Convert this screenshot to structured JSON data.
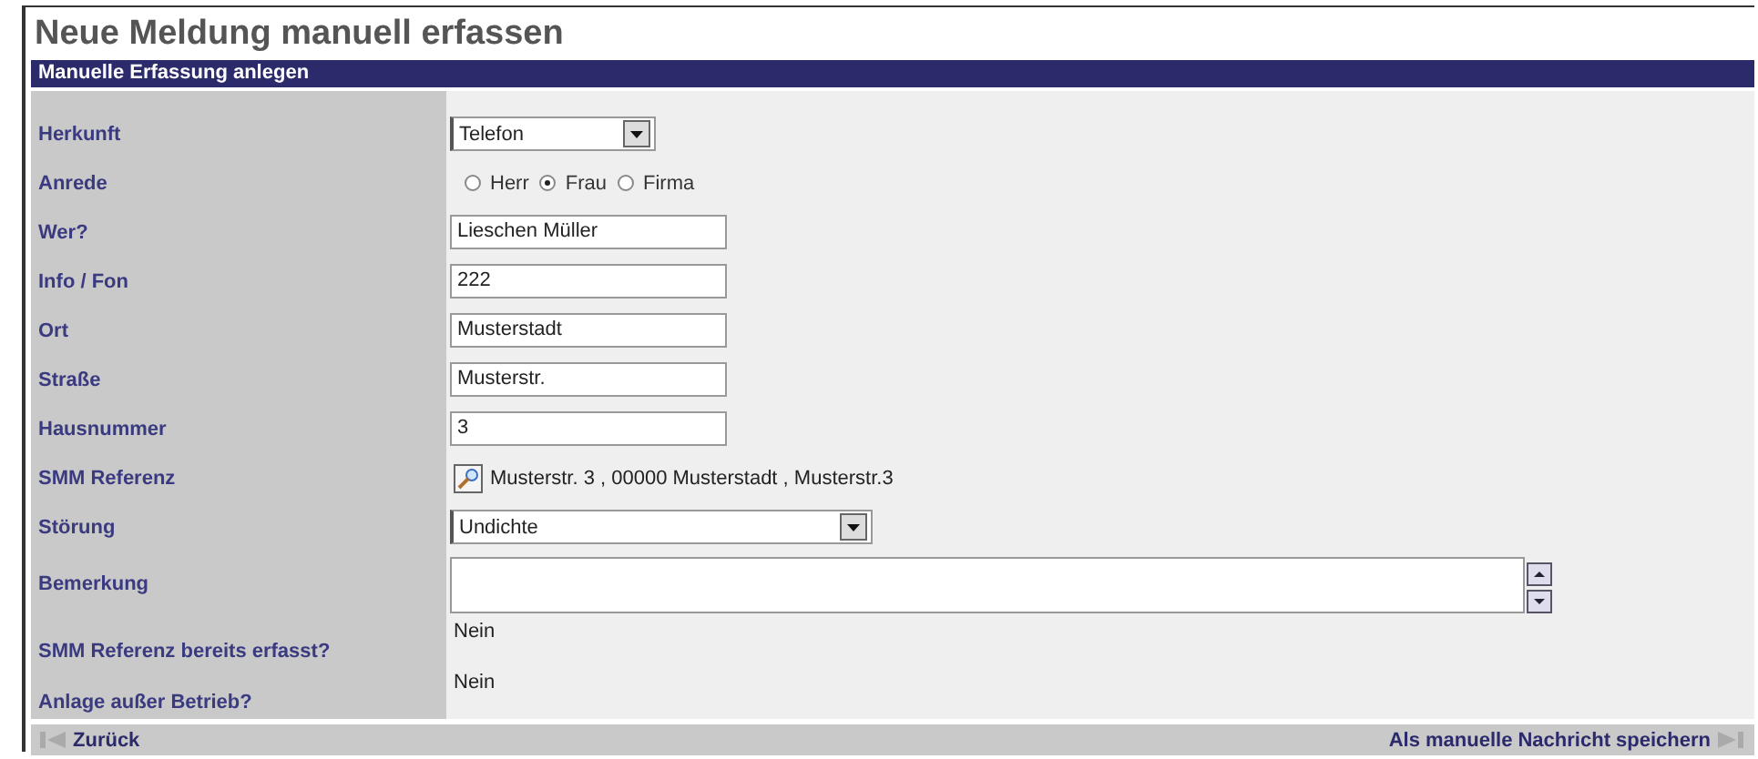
{
  "title": "Neue Meldung manuell erfassen",
  "section_header": "Manuelle Erfassung anlegen",
  "fields": [
    {
      "kind": "select",
      "label": "Herkunft",
      "value": "Telefon"
    },
    {
      "kind": "radio",
      "label": "Anrede",
      "options": [
        {
          "label": "Herr",
          "selected": false
        },
        {
          "label": "Frau",
          "selected": true
        },
        {
          "label": "Firma",
          "selected": false
        }
      ]
    },
    {
      "kind": "text",
      "label": "Wer?",
      "value": "Lieschen Müller"
    },
    {
      "kind": "text",
      "label": "Info / Fon",
      "value": "222"
    },
    {
      "kind": "text",
      "label": "Ort",
      "value": "Musterstadt"
    },
    {
      "kind": "text",
      "label": "Straße",
      "value": "Musterstr."
    },
    {
      "kind": "text",
      "label": "Hausnummer",
      "value": "3"
    },
    {
      "kind": "reference",
      "label": "SMM Referenz",
      "value": "Musterstr. 3 , 00000 Musterstadt , Musterstr.3"
    },
    {
      "kind": "select",
      "label": "Störung",
      "value": "Undichte"
    },
    {
      "kind": "textarea",
      "label": "Bemerkung"
    },
    {
      "kind": "static",
      "label": "SMM Referenz bereits erfasst?",
      "value": "Nein"
    },
    {
      "kind": "static",
      "label": "Anlage außer Betrieb?",
      "value": "Nein"
    }
  ],
  "footer": {
    "back_link": "Zurück",
    "save_link": "Als manuelle Nachricht speichern"
  }
}
